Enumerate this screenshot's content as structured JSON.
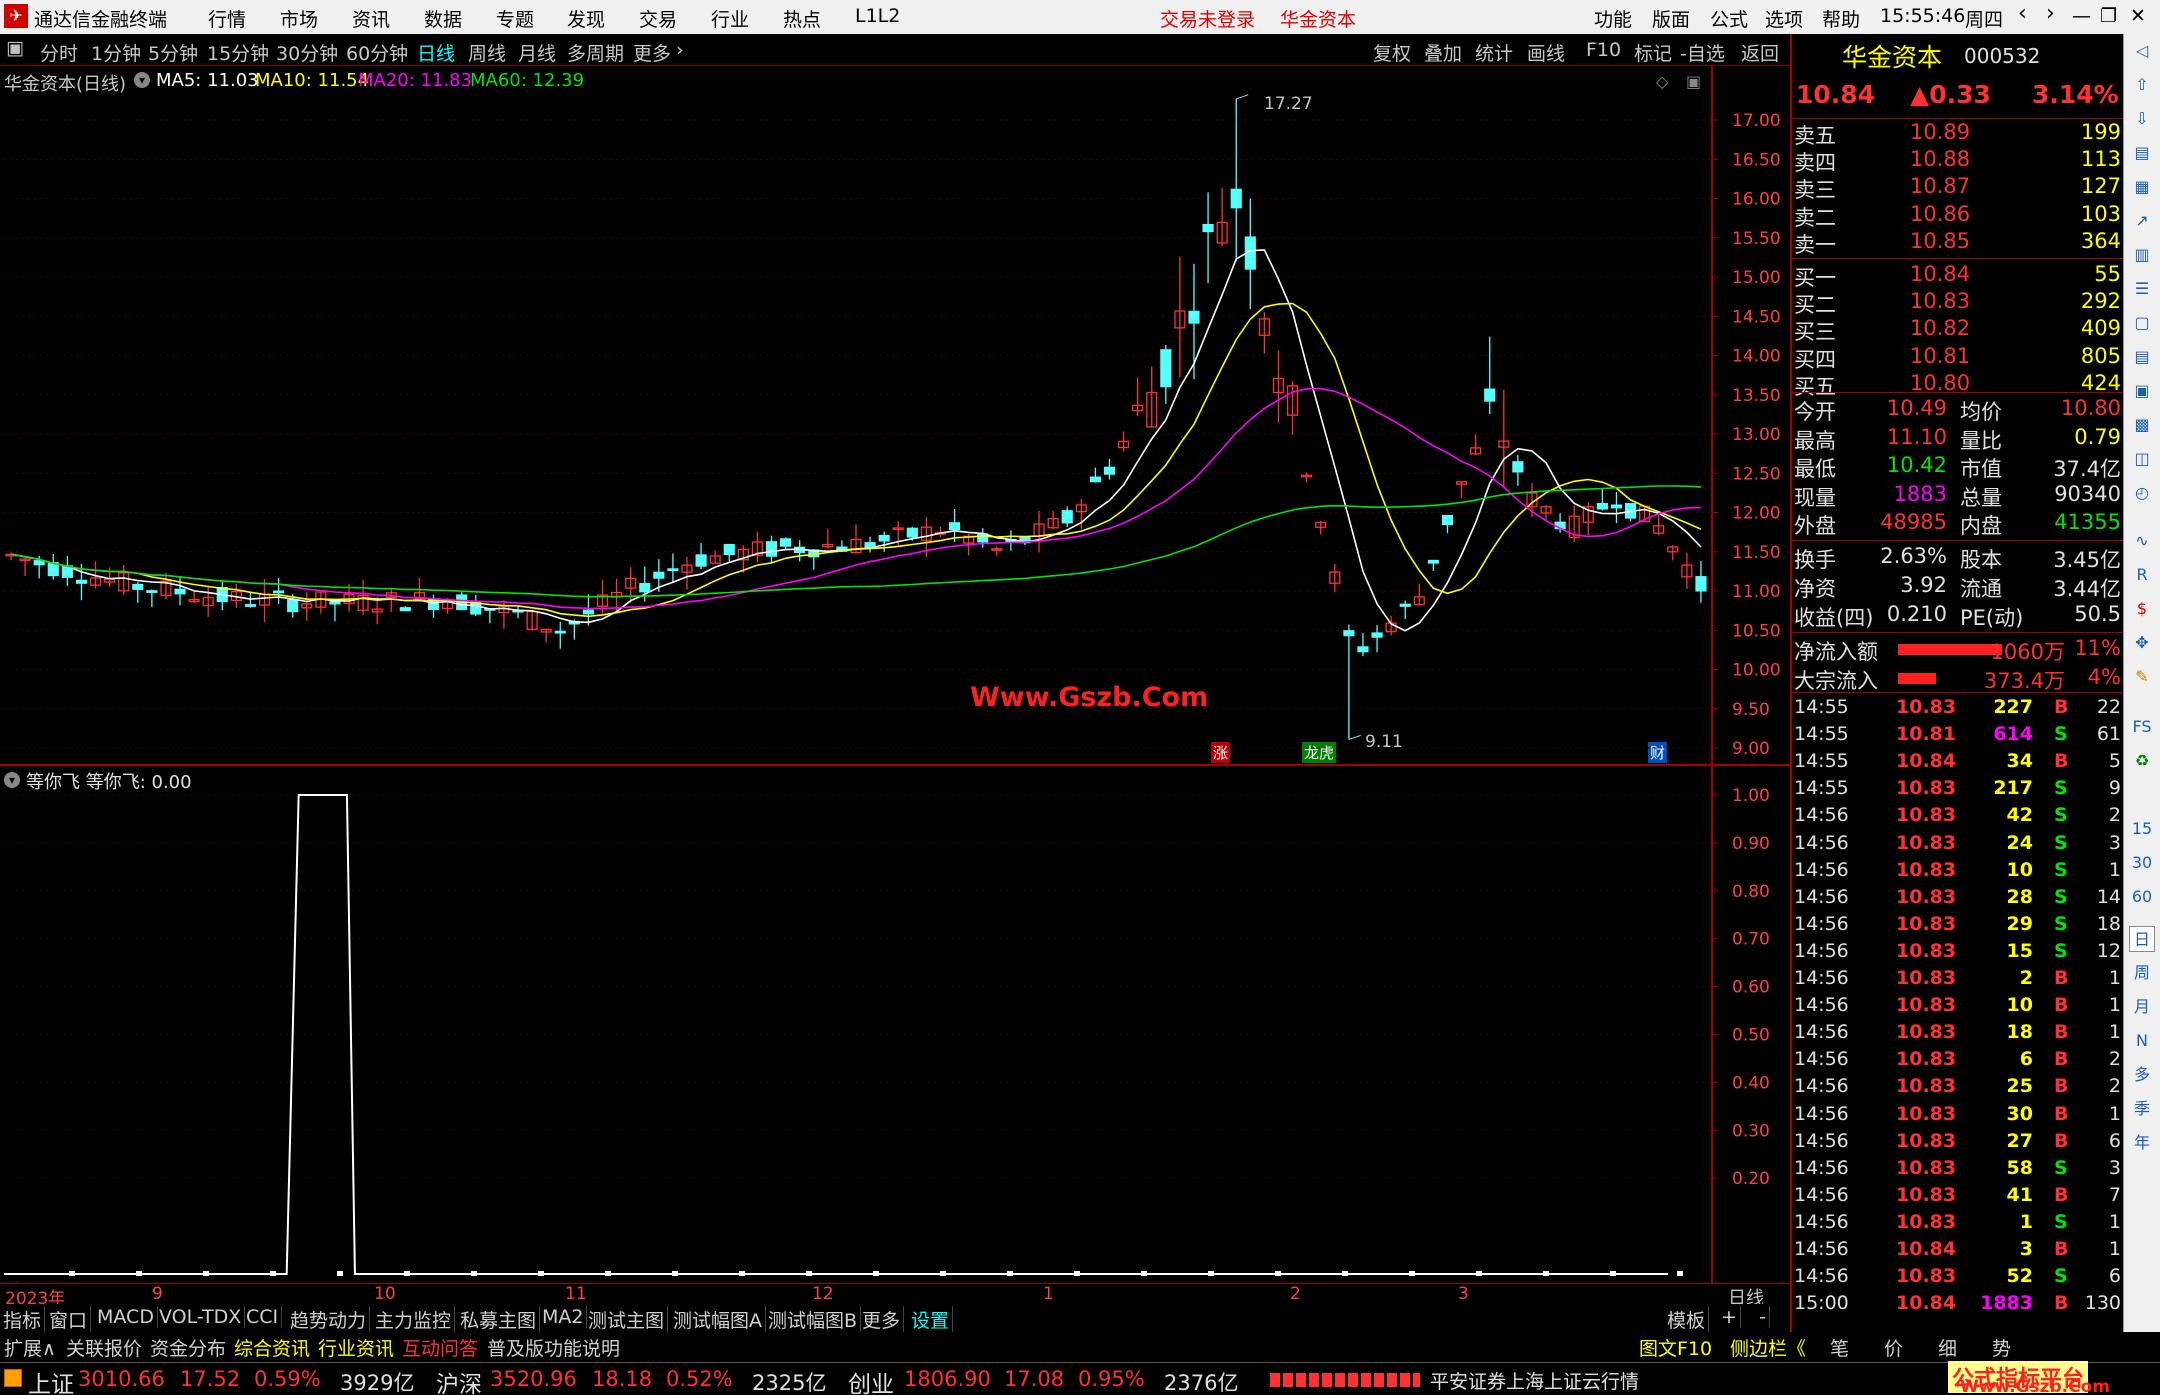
{
  "titlebar": {
    "app_name": "通达信金融终端",
    "menus": [
      "行情",
      "市场",
      "资讯",
      "数据",
      "专题",
      "发现",
      "交易",
      "行业",
      "热点",
      "L1L2"
    ],
    "login_status": "交易未登录",
    "stock_name": "华金资本",
    "right_menus": [
      "功能",
      "版面",
      "公式",
      "选项",
      "帮助"
    ],
    "time": "15:55:46",
    "weekday": "周四"
  },
  "periodbar": {
    "periods": [
      "分时",
      "1分钟",
      "5分钟",
      "15分钟",
      "30分钟",
      "60分钟",
      "日线",
      "周线",
      "月线",
      "多周期",
      "更多"
    ],
    "active": "日线",
    "tools": [
      "复权",
      "叠加",
      "统计",
      "画线",
      "F10",
      "标记",
      "-自选",
      "返回"
    ]
  },
  "mainchart": {
    "title": "华金资本(日线)",
    "ma5": "MA5: 11.03",
    "ma10": "MA10: 11.54",
    "ma20": "MA20: 11.83",
    "ma60": "MA60: 12.39",
    "high_label": "17.27",
    "low_label": "9.11",
    "watermark": "Www.Gszb.Com",
    "marks": [
      "涨",
      "龙虎",
      "财"
    ],
    "y_ticks": [
      "17.00",
      "16.50",
      "16.00",
      "15.50",
      "15.00",
      "14.50",
      "14.00",
      "13.50",
      "13.00",
      "12.50",
      "12.00",
      "11.50",
      "11.00",
      "10.50",
      "10.00",
      "9.50",
      "9.00"
    ]
  },
  "subchart": {
    "title": "等你飞 等你飞: 0.00",
    "y_ticks": [
      "1.00",
      "0.90",
      "0.80",
      "0.70",
      "0.60",
      "0.50",
      "0.40",
      "0.30",
      "0.20"
    ],
    "x_labels": [
      "2023年",
      "9",
      "10",
      "11",
      "12",
      "1",
      "2",
      "3"
    ],
    "period_label": "日线"
  },
  "chart_data": {
    "type": "line",
    "title": "华金资本(日线)",
    "ylim": [
      9.0,
      17.27
    ],
    "high": 17.27,
    "low": 9.11,
    "ma": {
      "MA5": 11.03,
      "MA10": 11.54,
      "MA20": 11.83,
      "MA60": 12.39
    },
    "indicator": {
      "name": "等你飞",
      "value": 0.0,
      "ylim": [
        0,
        1.0
      ]
    }
  },
  "tabbar": {
    "tabs": [
      "指标",
      "窗口",
      "MACD",
      "VOL-TDX",
      "CCI",
      "趋势动力",
      "主力监控",
      "私募主图",
      "MA2",
      "测试主图",
      "测试幅图A",
      "测试幅图B",
      "更多",
      "设置"
    ],
    "right": [
      "模板",
      "+",
      "-"
    ]
  },
  "bottombar": {
    "items": [
      "扩展∧",
      "关联报价",
      "资金分布",
      "综合资讯",
      "行业资讯",
      "互动问答",
      "普及版功能说明"
    ],
    "right": [
      "图文F10",
      "侧边栏《",
      "笔",
      "价",
      "细",
      "势"
    ]
  },
  "statusbar": {
    "sh_label": "上证",
    "sh_value": "3010.66",
    "sh_change": "17.52",
    "sh_pct": "0.59%",
    "sh_amount": "3929亿",
    "sz_label": "沪深",
    "sz_value": "3520.96",
    "sz_change": "18.18",
    "sz_pct": "0.52%",
    "sz_amount": "2325亿",
    "cy_label": "创业",
    "cy_value": "1806.90",
    "cy_change": "17.08",
    "cy_pct": "0.95%",
    "cy_amount": "2376亿",
    "server": "平安证券上海上证云行情",
    "brand": "公式指标平台",
    "brand_url": "Www.Gszb.Com"
  },
  "quote": {
    "name": "华金资本",
    "code": "000532",
    "price": "10.84",
    "change": "▲0.33",
    "pct": "3.14%",
    "asks": [
      {
        "label": "卖五",
        "price": "10.89",
        "vol": "199"
      },
      {
        "label": "卖四",
        "price": "10.88",
        "vol": "113"
      },
      {
        "label": "卖三",
        "price": "10.87",
        "vol": "127"
      },
      {
        "label": "卖二",
        "price": "10.86",
        "vol": "103"
      },
      {
        "label": "卖一",
        "price": "10.85",
        "vol": "364"
      }
    ],
    "bids": [
      {
        "label": "买一",
        "price": "10.84",
        "vol": "55"
      },
      {
        "label": "买二",
        "price": "10.83",
        "vol": "292"
      },
      {
        "label": "买三",
        "price": "10.82",
        "vol": "409"
      },
      {
        "label": "买四",
        "price": "10.81",
        "vol": "805"
      },
      {
        "label": "买五",
        "price": "10.80",
        "vol": "424"
      }
    ],
    "stats": [
      {
        "l1": "今开",
        "v1": "10.49",
        "c1": "red",
        "l2": "均价",
        "v2": "10.80",
        "c2": "red"
      },
      {
        "l1": "最高",
        "v1": "11.10",
        "c1": "red",
        "l2": "量比",
        "v2": "0.79",
        "c2": "yellow"
      },
      {
        "l1": "最低",
        "v1": "10.42",
        "c1": "green",
        "l2": "市值",
        "v2": "37.4亿",
        "c2": "white"
      },
      {
        "l1": "现量",
        "v1": "1883",
        "c1": "magenta",
        "l2": "总量",
        "v2": "90340",
        "c2": "white"
      },
      {
        "l1": "外盘",
        "v1": "48985",
        "c1": "red",
        "l2": "内盘",
        "v2": "41355",
        "c2": "green"
      }
    ],
    "stats2": [
      {
        "l1": "换手",
        "v1": "2.63%",
        "l2": "股本",
        "v2": "3.45亿"
      },
      {
        "l1": "净资",
        "v1": "3.92",
        "l2": "流通",
        "v2": "3.44亿"
      },
      {
        "l1": "收益(四)",
        "v1": "0.210",
        "l2": "PE(动)",
        "v2": "50.5"
      }
    ],
    "flows": [
      {
        "label": "净流入额",
        "value": "1060万",
        "pct": "11%",
        "bar": 0.11
      },
      {
        "label": "大宗流入",
        "value": "373.4万",
        "pct": "4%",
        "bar": 0.04
      }
    ],
    "trades": [
      [
        "14:55",
        "10.83",
        "227",
        "B",
        "22"
      ],
      [
        "14:55",
        "10.81",
        "614",
        "S",
        "61"
      ],
      [
        "14:55",
        "10.84",
        "34",
        "B",
        "5"
      ],
      [
        "14:55",
        "10.83",
        "217",
        "S",
        "9"
      ],
      [
        "14:56",
        "10.83",
        "42",
        "S",
        "2"
      ],
      [
        "14:56",
        "10.83",
        "24",
        "S",
        "3"
      ],
      [
        "14:56",
        "10.83",
        "10",
        "S",
        "1"
      ],
      [
        "14:56",
        "10.83",
        "28",
        "S",
        "14"
      ],
      [
        "14:56",
        "10.83",
        "29",
        "S",
        "18"
      ],
      [
        "14:56",
        "10.83",
        "15",
        "S",
        "12"
      ],
      [
        "14:56",
        "10.83",
        "2",
        "B",
        "1"
      ],
      [
        "14:56",
        "10.83",
        "10",
        "B",
        "1"
      ],
      [
        "14:56",
        "10.83",
        "18",
        "B",
        "1"
      ],
      [
        "14:56",
        "10.83",
        "6",
        "B",
        "2"
      ],
      [
        "14:56",
        "10.83",
        "25",
        "B",
        "2"
      ],
      [
        "14:56",
        "10.83",
        "30",
        "B",
        "1"
      ],
      [
        "14:56",
        "10.83",
        "27",
        "B",
        "6"
      ],
      [
        "14:56",
        "10.83",
        "58",
        "S",
        "3"
      ],
      [
        "14:56",
        "10.83",
        "41",
        "B",
        "7"
      ],
      [
        "14:56",
        "10.83",
        "1",
        "S",
        "1"
      ],
      [
        "14:56",
        "10.84",
        "3",
        "B",
        "1"
      ],
      [
        "14:56",
        "10.83",
        "52",
        "S",
        "6"
      ],
      [
        "15:00",
        "10.84",
        "1883",
        "B",
        "130"
      ]
    ]
  },
  "toolcol": {
    "labels": [
      "FS",
      "15",
      "30",
      "60",
      "日",
      "周",
      "月",
      "N",
      "多",
      "季",
      "年"
    ]
  },
  "colors": {
    "up": "#ff3232",
    "down": "#54ffff",
    "ma5": "#ffffff",
    "ma10": "#ffff00",
    "ma20": "#ff00ff",
    "ma60": "#00e600",
    "axis": "#a00000"
  }
}
